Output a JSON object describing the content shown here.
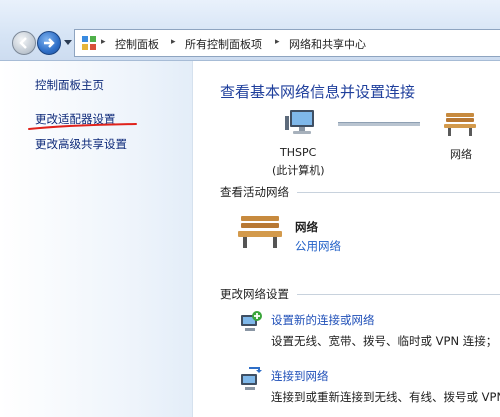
{
  "address_bar": {
    "breadcrumbs": [
      "控制面板",
      "所有控制面板项",
      "网络和共享中心"
    ],
    "separator": "▸"
  },
  "sidebar": {
    "items": [
      {
        "label": "控制面板主页"
      },
      {
        "label": "更改适配器设置"
      },
      {
        "label": "更改高级共享设置"
      }
    ],
    "underline_color": "#e0221b"
  },
  "main": {
    "title": "查看基本网络信息并设置连接",
    "map": {
      "computer_name": "THSPC",
      "computer_sub": "(此计算机)",
      "network_label": "网络"
    },
    "active_section": {
      "heading": "查看活动网络",
      "network_name": "网络",
      "network_type": "公用网络"
    },
    "change_section": {
      "heading": "更改网络设置",
      "tasks": [
        {
          "link": "设置新的连接或网络",
          "desc": "设置无线、宽带、拨号、临时或 VPN 连接；",
          "icon": "new-connection-icon"
        },
        {
          "link": "连接到网络",
          "desc": "连接到或重新连接到无线、有线、拨号或 VPN",
          "icon": "connect-network-icon"
        }
      ]
    }
  },
  "colors": {
    "link_blue": "#1f4fb8",
    "title_blue": "#1f3f9c",
    "sidebar_link": "#0e2a7a"
  }
}
